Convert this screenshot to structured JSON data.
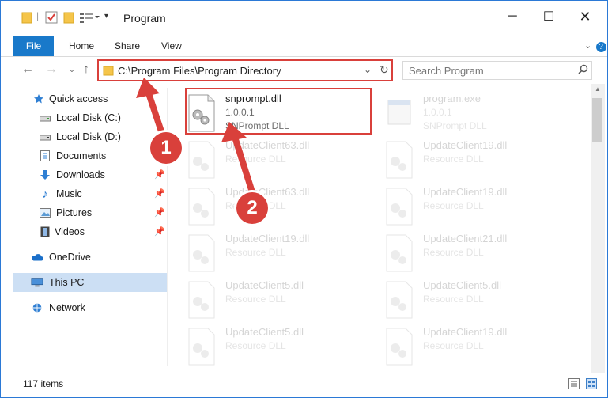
{
  "window": {
    "title": "Program",
    "accent_color": "#1979ca",
    "highlight_color": "#d9403b"
  },
  "ribbon": {
    "tabs": [
      "File",
      "Home",
      "Share",
      "View"
    ]
  },
  "address_bar": {
    "path": "C:\\Program Files\\Program Directory"
  },
  "search": {
    "placeholder": "Search Program"
  },
  "sidebar": {
    "items": [
      {
        "label": "Quick access",
        "icon": "star-icon"
      },
      {
        "label": "Local Disk (C:)",
        "icon": "drive-icon"
      },
      {
        "label": "Local Disk (D:)",
        "icon": "drive-icon"
      },
      {
        "label": "Documents",
        "icon": "documents-icon"
      },
      {
        "label": "Downloads",
        "icon": "download-icon"
      },
      {
        "label": "Music",
        "icon": "music-icon"
      },
      {
        "label": "Pictures",
        "icon": "pictures-icon"
      },
      {
        "label": "Videos",
        "icon": "videos-icon"
      },
      {
        "label": "OneDrive",
        "icon": "cloud-icon"
      },
      {
        "label": "This PC",
        "icon": "computer-icon"
      },
      {
        "label": "Network",
        "icon": "network-icon"
      }
    ]
  },
  "files": [
    {
      "name": "snprompt.dll",
      "version": "1.0.0.1",
      "description": "SNPrompt DLL",
      "highlighted": true
    },
    {
      "name": "program.exe",
      "version": "1.0.0.1",
      "description": "SNPrompt DLL"
    },
    {
      "name": "UpdateClient63.dll",
      "description": "Resource DLL"
    },
    {
      "name": "UpdateClient19.dll",
      "description": "Resource DLL"
    },
    {
      "name": "UpdateClient63.dll",
      "description": "Resource DLL"
    },
    {
      "name": "UpdateClient19.dll",
      "description": "Resource DLL"
    },
    {
      "name": "UpdateClient19.dll",
      "description": "Resource DLL"
    },
    {
      "name": "UpdateClient21.dll",
      "description": "Resource DLL"
    },
    {
      "name": "UpdateClient5.dll",
      "description": "Resource DLL"
    },
    {
      "name": "UpdateClient5.dll",
      "description": "Resource DLL"
    },
    {
      "name": "UpdateClient5.dll",
      "description": "Resource DLL"
    },
    {
      "name": "UpdateClient19.dll",
      "description": "Resource DLL"
    }
  ],
  "status": {
    "item_count": "117 items"
  },
  "annotations": {
    "badge_1": "1",
    "badge_2": "2"
  }
}
